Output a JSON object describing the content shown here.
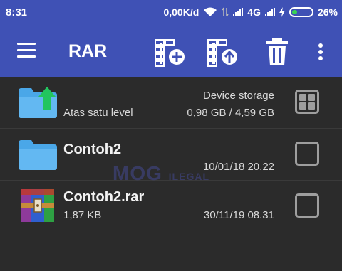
{
  "status_bar": {
    "time": "8:31",
    "speed": "0,00K/d",
    "network": "4G",
    "battery": "26%"
  },
  "app_bar": {
    "title": "RAR",
    "icons": [
      "menu-icon",
      "archive-add-icon",
      "archive-extract-icon",
      "trash-icon",
      "more-vert-icon"
    ]
  },
  "rows": [
    {
      "name": "",
      "sub": "Atas satu level",
      "meta_top": "Device storage",
      "meta_bottom": "0,98 GB / 4,59 GB",
      "icon": "folder-up-icon"
    },
    {
      "name": "Contoh2",
      "sub": "",
      "meta_top": "",
      "meta_bottom": "10/01/18 20.22",
      "icon": "folder-icon"
    },
    {
      "name": "Contoh2.rar",
      "sub": "1,87 KB",
      "meta_top": "",
      "meta_bottom": "30/11/19 08.31",
      "icon": "rar-archive-icon"
    }
  ],
  "watermark": {
    "text": "MOG",
    "small": "ILEGAL"
  },
  "colors": {
    "accent": "#3f51b5",
    "background": "#2b2b2b",
    "folder": "#4aa7e8",
    "up_arrow": "#22c55e"
  }
}
